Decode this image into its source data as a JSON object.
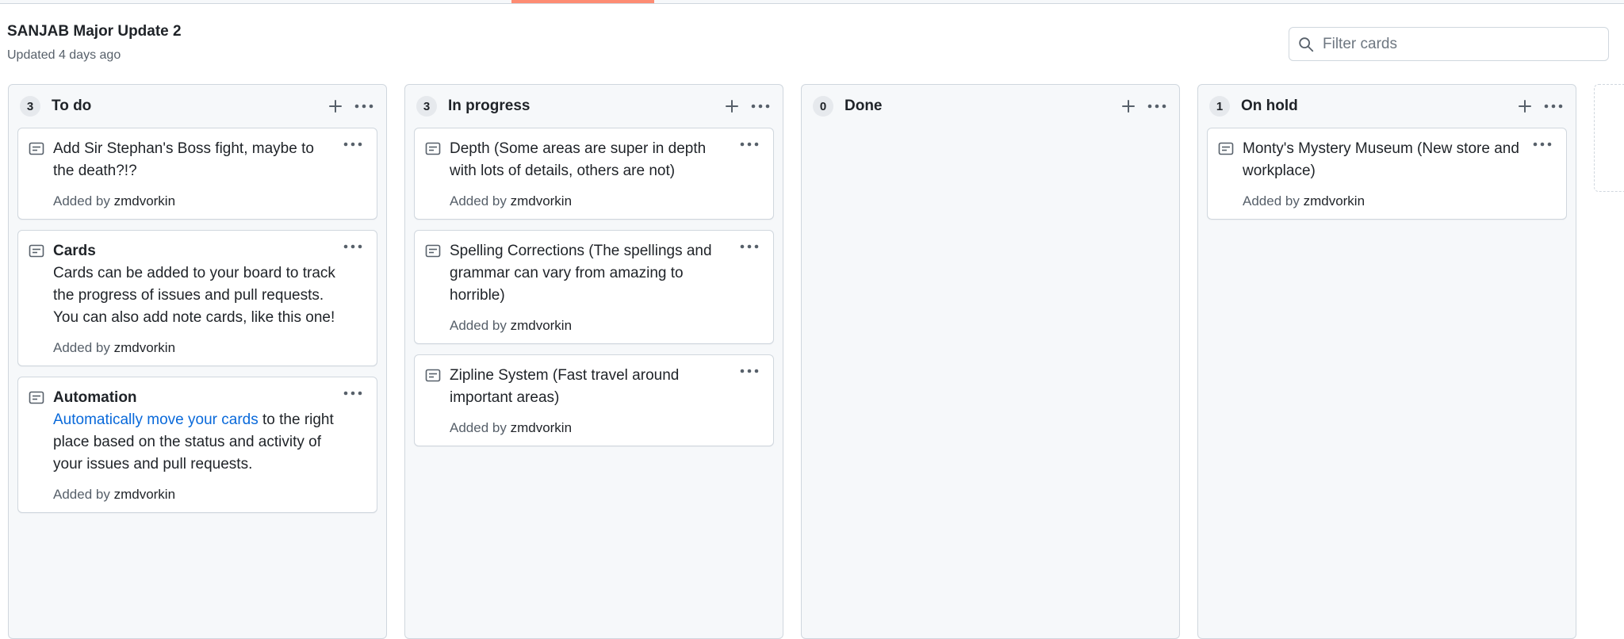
{
  "board": {
    "title": "SANJAB Major Update 2",
    "updated": "Updated 4 days ago"
  },
  "filter": {
    "placeholder": "Filter cards"
  },
  "columns": [
    {
      "count": "3",
      "name": "To do",
      "cards": [
        {
          "title": "Add Sir Stephan's Boss fight, maybe to the death?!?",
          "added_prefix": "Added by",
          "user": "zmdvorkin"
        },
        {
          "title": "Cards",
          "body": "Cards can be added to your board to track the progress of issues and pull requests. You can also add note cards, like this one!",
          "added_prefix": "Added by",
          "user": "zmdvorkin"
        },
        {
          "title": "Automation",
          "link": "Automatically move your cards",
          "body": " to the right place based on the status and activity of your issues and pull requests.",
          "added_prefix": "Added by",
          "user": "zmdvorkin"
        }
      ]
    },
    {
      "count": "3",
      "name": "In progress",
      "cards": [
        {
          "title": "Depth (Some areas are super in depth with lots of details, others are not)",
          "added_prefix": "Added by",
          "user": "zmdvorkin"
        },
        {
          "title": "Spelling Corrections (The spellings and grammar can vary from amazing to horrible)",
          "added_prefix": "Added by",
          "user": "zmdvorkin"
        },
        {
          "title": "Zipline System (Fast travel around important areas)",
          "added_prefix": "Added by",
          "user": "zmdvorkin"
        }
      ]
    },
    {
      "count": "0",
      "name": "Done",
      "cards": []
    },
    {
      "count": "1",
      "name": "On hold",
      "cards": [
        {
          "title": "Monty's Mystery Museum (New store and workplace)",
          "added_prefix": "Added by",
          "user": "zmdvorkin"
        }
      ]
    }
  ],
  "colors": {
    "accent_tab": "#fd8c73",
    "link": "#0969da",
    "column_bg": "#f6f8fa"
  },
  "icons": [
    "search-icon",
    "plus-icon",
    "kebab-menu-icon",
    "note-icon"
  ]
}
